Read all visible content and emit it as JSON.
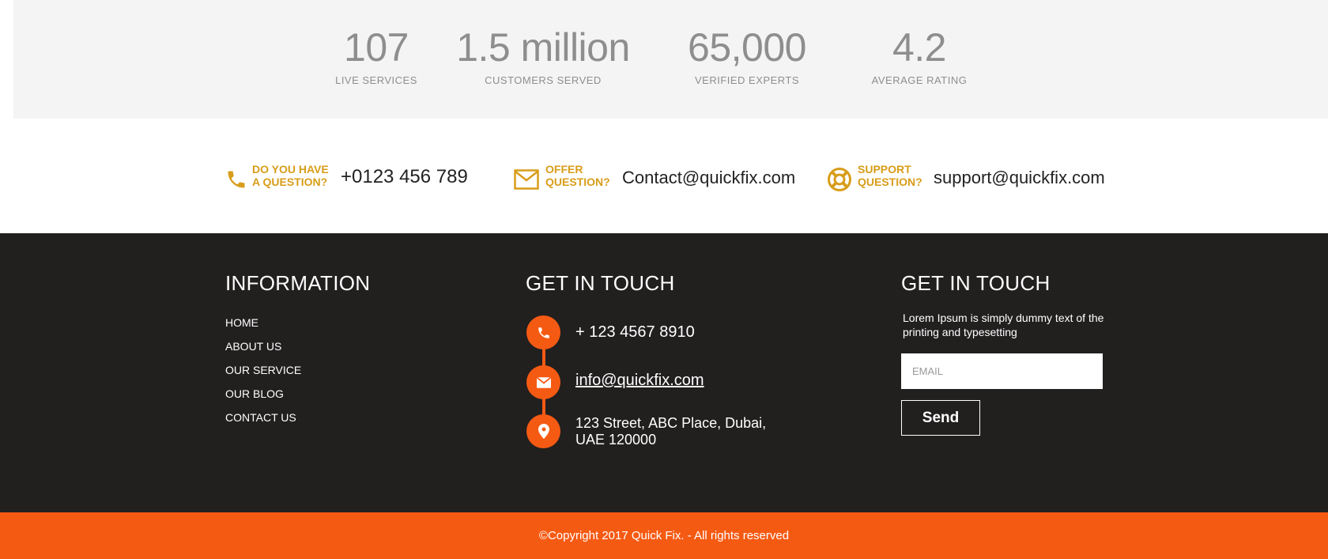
{
  "stats": [
    {
      "value": "107",
      "label": "LIVE SERVICES"
    },
    {
      "value": "1.5 million",
      "label": "CUSTOMERS SERVED"
    },
    {
      "value": "65,000",
      "label": "VERIFIED EXPERTS"
    },
    {
      "value": "4.2",
      "label": "AVERAGE RATING"
    }
  ],
  "contact_strip": {
    "accent": "#d89d1a",
    "items": [
      {
        "icon": "phone-icon",
        "question_line1": "DO YOU HAVE",
        "question_line2": "A QUESTION?",
        "value": "+0123 456 789"
      },
      {
        "icon": "envelope-icon",
        "question_line1": "OFFER",
        "question_line2": "QUESTION?",
        "value": "Contact@quickfix.com"
      },
      {
        "icon": "lifebuoy-icon",
        "question_line1": "SUPPORT",
        "question_line2": "QUESTION?",
        "value": "support@quickfix.com"
      }
    ]
  },
  "footer": {
    "information": {
      "title": "INFORMATION",
      "links": [
        "HOME",
        "ABOUT US",
        "OUR SERVICE",
        "OUR BLOG",
        "CONTACT US"
      ]
    },
    "get_in_touch": {
      "title": "GET IN TOUCH",
      "phone": "+ 123 4567 8910",
      "email": "info@quickfix.com",
      "address_line1": "123 Street, ABC Place, Dubai,",
      "address_line2": "UAE 120000"
    },
    "newsletter": {
      "title": "GET IN TOUCH",
      "description": "Lorem Ipsum is simply dummy text of the printing and typesetting",
      "email_placeholder": "EMAIL",
      "send_label": "Send"
    }
  },
  "copyright": "©Copyright 2017 Quick Fix. - All rights reserved",
  "colors": {
    "accent_orange": "#f55a13",
    "gold": "#d89d1a",
    "footer_bg": "#221f1f",
    "stats_bg": "#f4f4f4"
  }
}
